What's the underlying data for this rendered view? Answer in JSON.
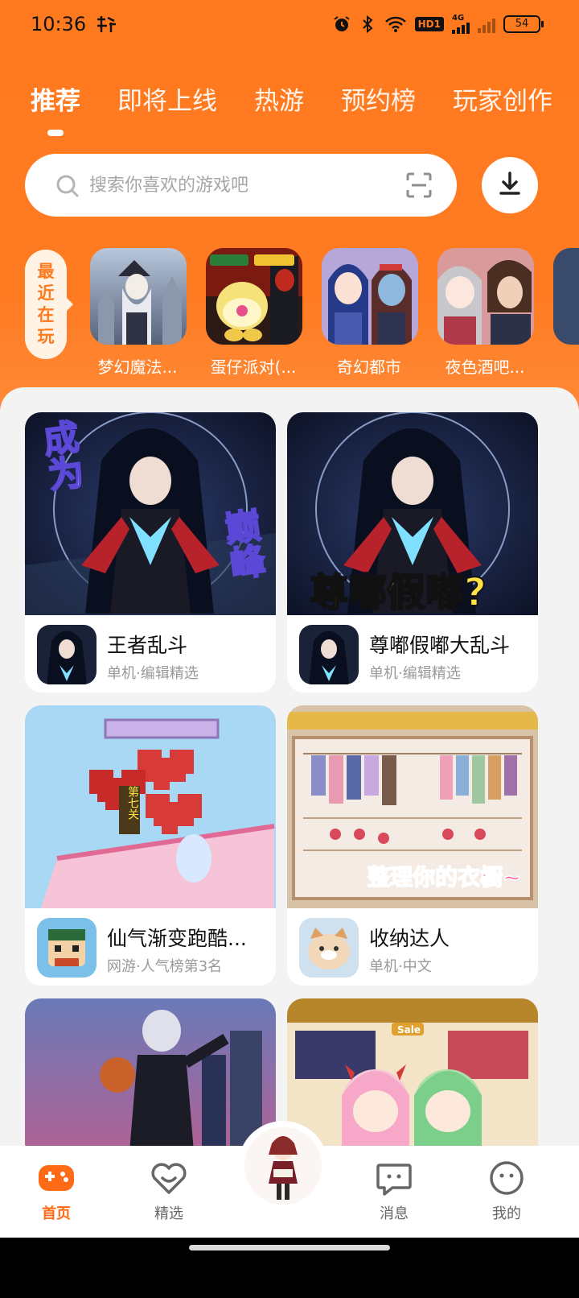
{
  "status_bar": {
    "time": "10:36",
    "battery": "54",
    "network": "4G",
    "hd_label": "HD1"
  },
  "tabs": [
    {
      "label": "推荐",
      "active": true
    },
    {
      "label": "即将上线",
      "active": false
    },
    {
      "label": "热游",
      "active": false
    },
    {
      "label": "预约榜",
      "active": false
    },
    {
      "label": "玩家创作",
      "active": false
    }
  ],
  "search": {
    "placeholder": "搜索你喜欢的游戏吧"
  },
  "recent": {
    "label": "最近在玩",
    "items": [
      {
        "name": "梦幻魔法..."
      },
      {
        "name": "蛋仔派对(..."
      },
      {
        "name": "奇幻都市"
      },
      {
        "name": "夜色酒吧..."
      }
    ]
  },
  "cards": [
    {
      "title": "王者乱斗",
      "sub": "单机·编辑精选",
      "banner_text_1": "成为",
      "banner_text_2": "巅峰"
    },
    {
      "title": "尊嘟假嘟大乱斗",
      "sub": "单机·编辑精选",
      "banner_text": "尊嘟假嘟?"
    },
    {
      "title": "仙气渐变跑酷...",
      "sub": "网游·人气榜第3名",
      "banner_text": "第七关"
    },
    {
      "title": "收纳达人",
      "sub": "单机·中文",
      "banner_text": "整理你的衣橱~"
    },
    {
      "banner_text": "Sale"
    }
  ],
  "nav": [
    {
      "label": "首页",
      "active": true
    },
    {
      "label": "精选",
      "active": false
    },
    {
      "label": "消息",
      "active": false
    },
    {
      "label": "我的",
      "active": false
    }
  ],
  "colors": {
    "accent": "#ff7a1e",
    "active_nav": "#ff6a16"
  }
}
